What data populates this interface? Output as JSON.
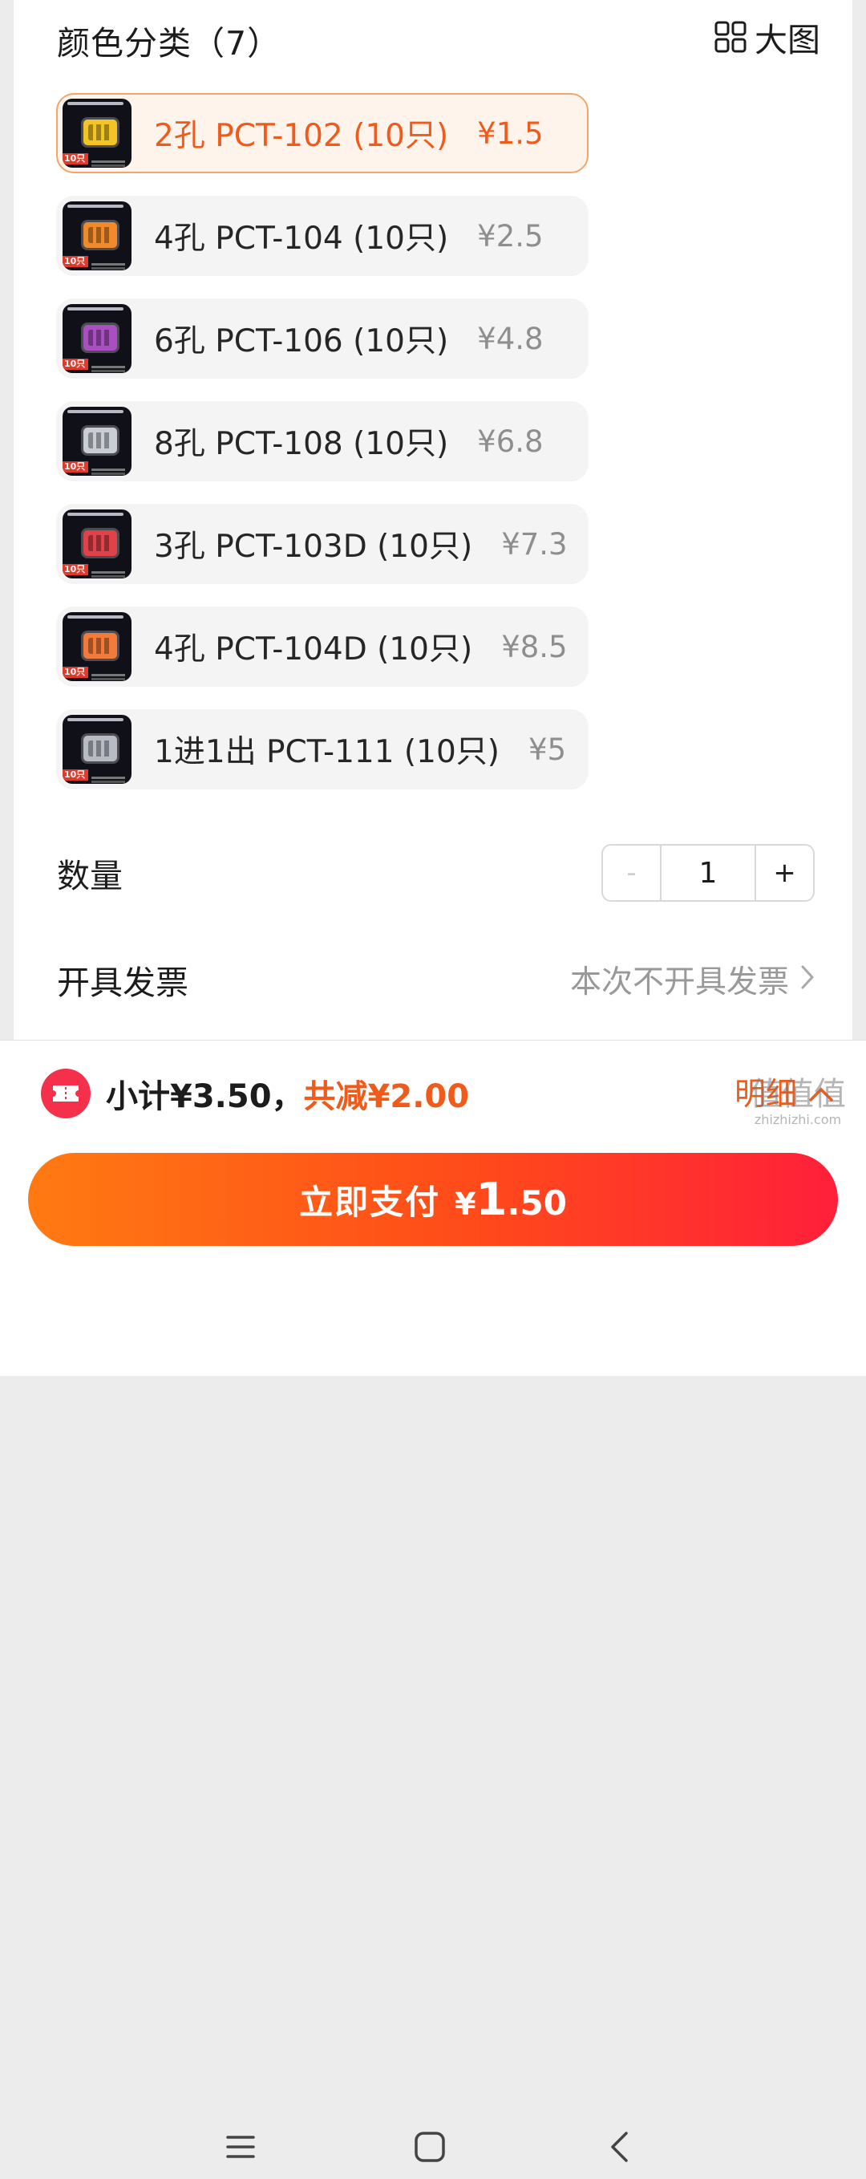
{
  "header": {
    "title": "颜色分类（7）",
    "view_toggle_label": "大图",
    "view_toggle_icon": "grid-icon"
  },
  "options": [
    {
      "name": "2孔 PCT-102 (10只)",
      "price": "¥1.5",
      "selected": true,
      "part_color": "#f2c425",
      "thumb_title": "PCT-102"
    },
    {
      "name": "4孔 PCT-104 (10只)",
      "price": "¥2.5",
      "selected": false,
      "part_color": "#f08a2a",
      "thumb_title": "PCT-104"
    },
    {
      "name": "6孔 PCT-106 (10只)",
      "price": "¥4.8",
      "selected": false,
      "part_color": "#a94fc2",
      "thumb_title": "PCT-106"
    },
    {
      "name": "8孔 PCT-108 (10只)",
      "price": "¥6.8",
      "selected": false,
      "part_color": "#c9cdd4",
      "thumb_title": "PCT-108"
    },
    {
      "name": "3孔 PCT-103D (10只)",
      "price": "¥7.3",
      "selected": false,
      "part_color": "#e0424a",
      "thumb_title": "PCT-103D"
    },
    {
      "name": "4孔 PCT-104D (10只)",
      "price": "¥8.5",
      "selected": false,
      "part_color": "#f27a3a",
      "thumb_title": "PCT-104D"
    },
    {
      "name": "1进1出 PCT-111 (10只)",
      "price": "¥5",
      "selected": false,
      "part_color": "#b7bcc4",
      "thumb_title": "PCT-111"
    }
  ],
  "thumb_badge": "10只",
  "quantity": {
    "label": "数量",
    "minus": "-",
    "value": "1",
    "plus": "+"
  },
  "invoice": {
    "label": "开具发票",
    "value": "本次不开具发票"
  },
  "summary": {
    "subtotal": "小计¥3.50，",
    "discount": "共减¥2.00",
    "detail_label": "明细"
  },
  "pay": {
    "label": "立即支付",
    "currency": "¥",
    "amount_int": "1",
    "amount_dec": ".50"
  },
  "watermark": {
    "glyphs": "值值值",
    "url": "zhizhizhi.com"
  },
  "colors": {
    "accent": "#f05a1a",
    "pay_gradient_start": "#ff7a12",
    "pay_gradient_end": "#ff1f3a",
    "coupon_icon": "#f5304a"
  }
}
